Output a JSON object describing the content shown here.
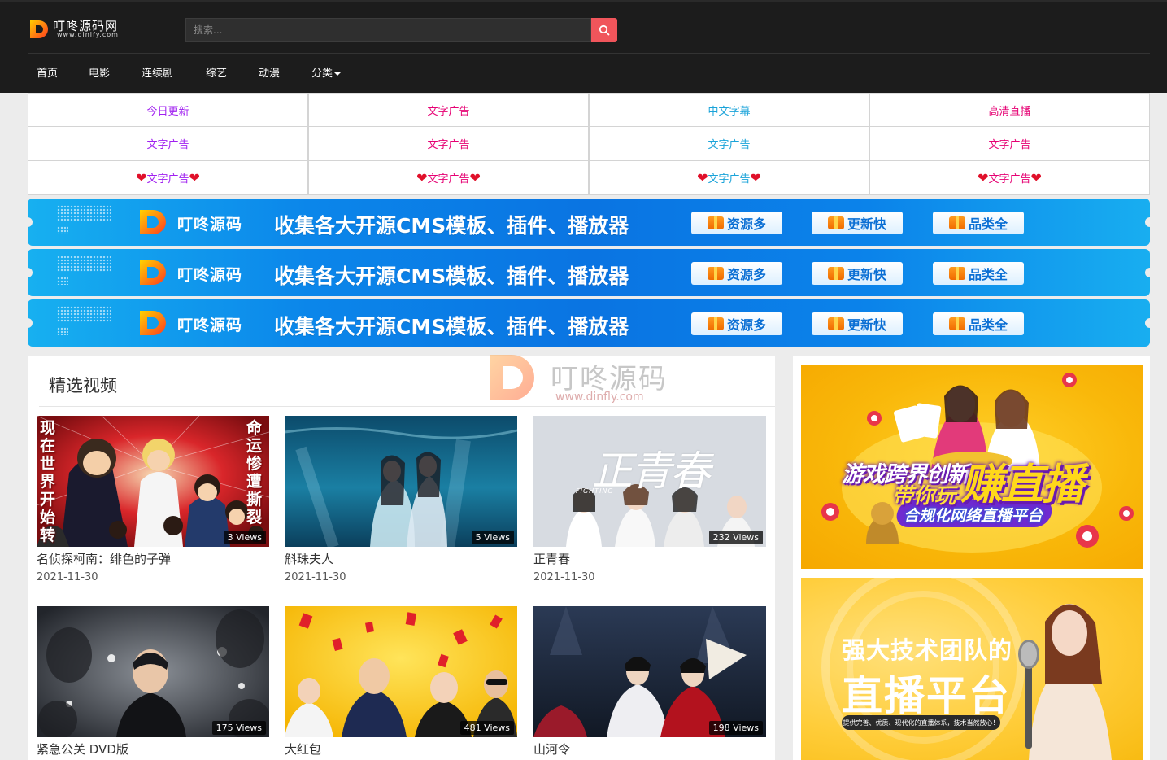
{
  "header": {
    "logo_title": "叮咚源码网",
    "logo_url": "www.dinlfy.com",
    "search_placeholder": "搜索...",
    "nav": [
      "首页",
      "电影",
      "连续剧",
      "综艺",
      "动漫",
      "分类"
    ]
  },
  "text_ads": [
    {
      "label": "今日更新",
      "color": "#a020f0"
    },
    {
      "label": "文字广告",
      "color": "#e60073"
    },
    {
      "label": "中文字幕",
      "color": "#1aa3d9"
    },
    {
      "label": "高清直播",
      "color": "#e60073"
    },
    {
      "label": "文字广告",
      "color": "#a020f0"
    },
    {
      "label": "文字广告",
      "color": "#e60073"
    },
    {
      "label": "文字广告",
      "color": "#1aa3d9"
    },
    {
      "label": "文字广告",
      "color": "#e60073"
    },
    {
      "label": "文字广告",
      "color": "#a020f0",
      "hearts": true
    },
    {
      "label": "文字广告",
      "color": "#e60073",
      "hearts": true
    },
    {
      "label": "文字广告",
      "color": "#1aa3d9",
      "hearts": true
    },
    {
      "label": "文字广告",
      "color": "#e60073",
      "hearts": true
    }
  ],
  "banner": {
    "brand": "叮咚源码",
    "slogan": "收集各大开源CMS模板、插件、播放器",
    "tags": [
      "资源多",
      "更新快",
      "品类全"
    ]
  },
  "main": {
    "title": "精选视频",
    "watermark_name": "叮咚源码",
    "watermark_url": "www.dinfly.com",
    "videos": [
      {
        "title": "名侦探柯南：绯色的子弹",
        "date": "2021-11-30",
        "views": "3 Views",
        "poster_text_left": "现在世界开始转",
        "poster_text_right": "命运惨遭撕裂"
      },
      {
        "title": "斛珠夫人",
        "date": "2021-11-30",
        "views": "5 Views"
      },
      {
        "title": "正青春",
        "date": "2021-11-30",
        "views": "232 Views",
        "poster_title": "正青春",
        "poster_sub": "FIGHTING"
      },
      {
        "title": "紧急公关 DVD版",
        "date": "",
        "views": "175 Views"
      },
      {
        "title": "大红包",
        "date": "",
        "views": "481 Views"
      },
      {
        "title": "山河令",
        "date": "",
        "views": "198 Views"
      }
    ]
  },
  "sidebar": {
    "ad1_line1": "游戏跨界创新",
    "ad1_big": "赚直播",
    "ad1_line2": "带你玩",
    "ad1_sub": "合规化网络直播平台",
    "ad2_line1": "强大技术团队的",
    "ad2_line2": "直播平台",
    "ad2_band": "提供完善、优质、现代化的直播体系，技术当然放心！"
  },
  "colors": {
    "header_bg": "#1c1c1c",
    "search_button": "#f0555b",
    "banner_blue": "#0a74e2",
    "heart": "#e0102a"
  }
}
